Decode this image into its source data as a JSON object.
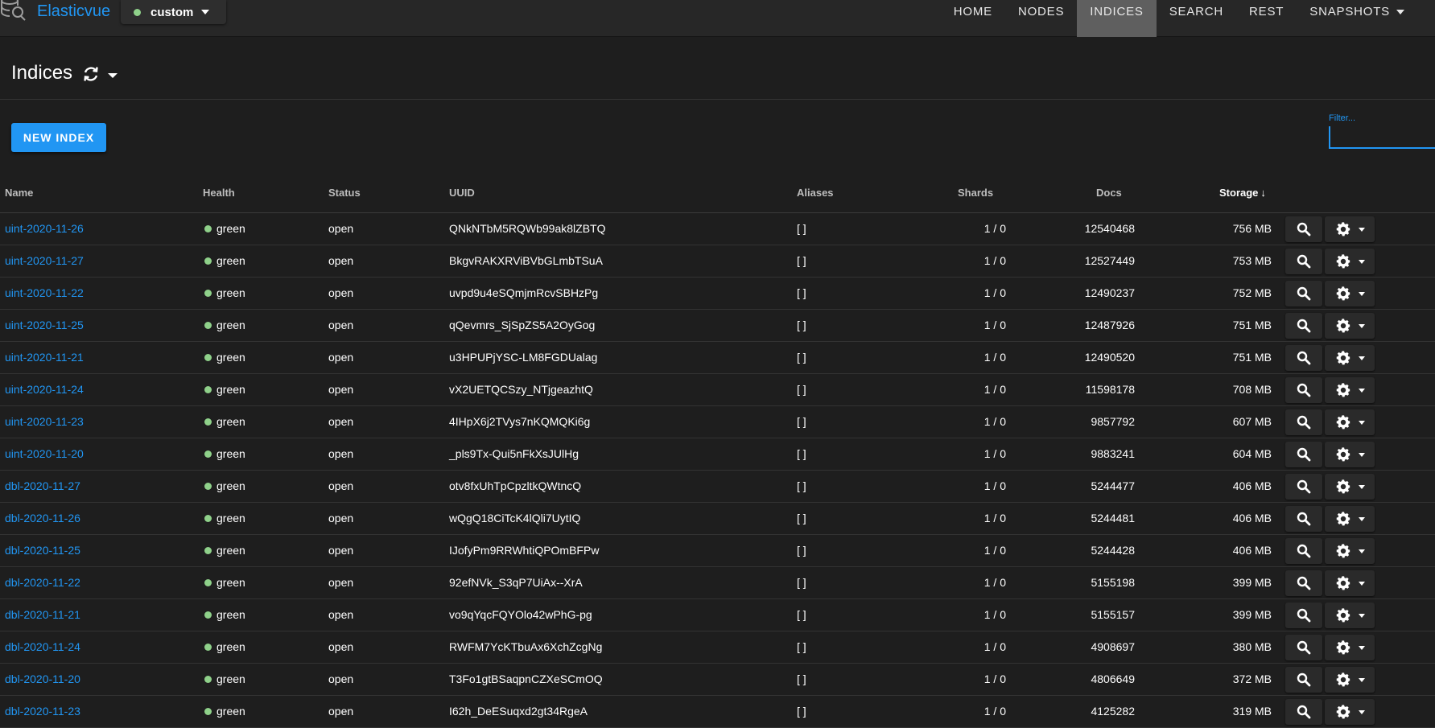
{
  "app": {
    "brand": "Elasticvue",
    "cluster_name": "custom",
    "cluster_status_color": "#8fd18a",
    "accent_color": "#2196f3"
  },
  "nav": {
    "items": [
      {
        "label": "HOME",
        "active": false
      },
      {
        "label": "NODES",
        "active": false
      },
      {
        "label": "INDICES",
        "active": true
      },
      {
        "label": "SEARCH",
        "active": false
      },
      {
        "label": "REST",
        "active": false
      },
      {
        "label": "SNAPSHOTS",
        "active": false,
        "has_dropdown": true
      }
    ]
  },
  "page": {
    "title": "Indices",
    "reload_icon": "sync-icon"
  },
  "toolbar": {
    "new_index_label": "NEW INDEX",
    "filter_placeholder": "Filter..."
  },
  "table": {
    "headers": {
      "name": "Name",
      "health": "Health",
      "status": "Status",
      "uuid": "UUID",
      "aliases": "Aliases",
      "shards": "Shards",
      "docs": "Docs",
      "storage": "Storage"
    },
    "sorted_by": "storage",
    "sort_direction": "desc",
    "rows": [
      {
        "name": "uint-2020-11-26",
        "health": "green",
        "status": "open",
        "uuid": "QNkNTbM5RQWb99ak8lZBTQ",
        "aliases": "[ ]",
        "shards": "1 / 0",
        "docs": "12540468",
        "storage": "756 MB"
      },
      {
        "name": "uint-2020-11-27",
        "health": "green",
        "status": "open",
        "uuid": "BkgvRAKXRViBVbGLmbTSuA",
        "aliases": "[ ]",
        "shards": "1 / 0",
        "docs": "12527449",
        "storage": "753 MB"
      },
      {
        "name": "uint-2020-11-22",
        "health": "green",
        "status": "open",
        "uuid": "uvpd9u4eSQmjmRcvSBHzPg",
        "aliases": "[ ]",
        "shards": "1 / 0",
        "docs": "12490237",
        "storage": "752 MB"
      },
      {
        "name": "uint-2020-11-25",
        "health": "green",
        "status": "open",
        "uuid": "qQevmrs_SjSpZS5A2OyGog",
        "aliases": "[ ]",
        "shards": "1 / 0",
        "docs": "12487926",
        "storage": "751 MB"
      },
      {
        "name": "uint-2020-11-21",
        "health": "green",
        "status": "open",
        "uuid": "u3HPUPjYSC-LM8FGDUalag",
        "aliases": "[ ]",
        "shards": "1 / 0",
        "docs": "12490520",
        "storage": "751 MB"
      },
      {
        "name": "uint-2020-11-24",
        "health": "green",
        "status": "open",
        "uuid": "vX2UETQCSzy_NTjgeazhtQ",
        "aliases": "[ ]",
        "shards": "1 / 0",
        "docs": "11598178",
        "storage": "708 MB"
      },
      {
        "name": "uint-2020-11-23",
        "health": "green",
        "status": "open",
        "uuid": "4IHpX6j2TVys7nKQMQKi6g",
        "aliases": "[ ]",
        "shards": "1 / 0",
        "docs": "9857792",
        "storage": "607 MB"
      },
      {
        "name": "uint-2020-11-20",
        "health": "green",
        "status": "open",
        "uuid": "_pls9Tx-Qui5nFkXsJUlHg",
        "aliases": "[ ]",
        "shards": "1 / 0",
        "docs": "9883241",
        "storage": "604 MB"
      },
      {
        "name": "dbl-2020-11-27",
        "health": "green",
        "status": "open",
        "uuid": "otv8fxUhTpCpzltkQWtncQ",
        "aliases": "[ ]",
        "shards": "1 / 0",
        "docs": "5244477",
        "storage": "406 MB"
      },
      {
        "name": "dbl-2020-11-26",
        "health": "green",
        "status": "open",
        "uuid": "wQgQ18CiTcK4lQli7UytIQ",
        "aliases": "[ ]",
        "shards": "1 / 0",
        "docs": "5244481",
        "storage": "406 MB"
      },
      {
        "name": "dbl-2020-11-25",
        "health": "green",
        "status": "open",
        "uuid": "IJofyPm9RRWhtiQPOmBFPw",
        "aliases": "[ ]",
        "shards": "1 / 0",
        "docs": "5244428",
        "storage": "406 MB"
      },
      {
        "name": "dbl-2020-11-22",
        "health": "green",
        "status": "open",
        "uuid": "92efNVk_S3qP7UiAx--XrA",
        "aliases": "[ ]",
        "shards": "1 / 0",
        "docs": "5155198",
        "storage": "399 MB"
      },
      {
        "name": "dbl-2020-11-21",
        "health": "green",
        "status": "open",
        "uuid": "vo9qYqcFQYOlo42wPhG-pg",
        "aliases": "[ ]",
        "shards": "1 / 0",
        "docs": "5155157",
        "storage": "399 MB"
      },
      {
        "name": "dbl-2020-11-24",
        "health": "green",
        "status": "open",
        "uuid": "RWFM7YcKTbuAx6XchZcgNg",
        "aliases": "[ ]",
        "shards": "1 / 0",
        "docs": "4908697",
        "storage": "380 MB"
      },
      {
        "name": "dbl-2020-11-20",
        "health": "green",
        "status": "open",
        "uuid": "T3Fo1gtBSaqpnCZXeSCmOQ",
        "aliases": "[ ]",
        "shards": "1 / 0",
        "docs": "4806649",
        "storage": "372 MB"
      },
      {
        "name": "dbl-2020-11-23",
        "health": "green",
        "status": "open",
        "uuid": "I62h_DeESuqxd2gt34RgeA",
        "aliases": "[ ]",
        "shards": "1 / 0",
        "docs": "4125282",
        "storage": "319 MB"
      }
    ]
  }
}
